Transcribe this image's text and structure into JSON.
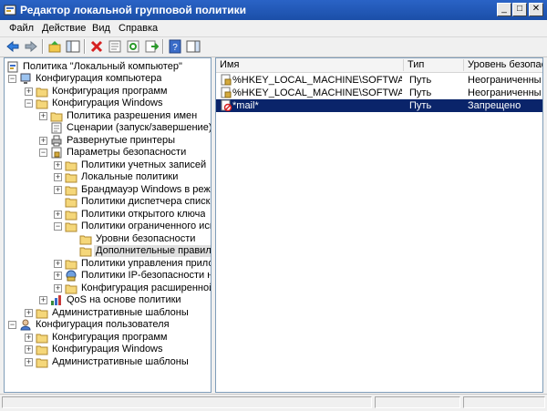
{
  "window": {
    "title": "Редактор локальной групповой политики",
    "min_glyph": "_",
    "max_glyph": "□",
    "close_glyph": "✕"
  },
  "menu": [
    "Файл",
    "Действие",
    "Вид",
    "Справка"
  ],
  "toolbar_icons": [
    "back-icon",
    "forward-icon",
    "up-icon",
    "show-hide-tree-icon",
    "delete-icon",
    "properties-icon",
    "refresh-icon",
    "export-icon",
    "help-icon",
    "view-icon"
  ],
  "tree": [
    {
      "label": "Политика \"Локальный компьютер\"",
      "icon": "policy-icon",
      "expander": ""
    },
    {
      "label": "Конфигурация компьютера",
      "icon": "computer-icon",
      "expander": "−"
    },
    {
      "label": "Конфигурация программ",
      "icon": "folder-icon",
      "expander": "+"
    },
    {
      "label": "Конфигурация Windows",
      "icon": "folder-icon",
      "expander": "−"
    },
    {
      "label": "Политика разрешения имен",
      "icon": "folder-icon",
      "expander": "+"
    },
    {
      "label": "Сценарии (запуск/завершение)",
      "icon": "scripts-icon",
      "expander": ""
    },
    {
      "label": "Развернутые принтеры",
      "icon": "printer-icon",
      "expander": "+"
    },
    {
      "label": "Параметры безопасности",
      "icon": "security-settings-icon",
      "expander": "−"
    },
    {
      "label": "Политики учетных записей",
      "icon": "folder-icon",
      "expander": "+"
    },
    {
      "label": "Локальные политики",
      "icon": "folder-icon",
      "expander": "+"
    },
    {
      "label": "Брандмауэр Windows в режиме по",
      "icon": "folder-icon",
      "expander": "+"
    },
    {
      "label": "Политики диспетчера списка сет",
      "icon": "folder-icon",
      "expander": ""
    },
    {
      "label": "Политики открытого ключа",
      "icon": "folder-icon",
      "expander": "+"
    },
    {
      "label": "Политики ограниченного исполь:",
      "icon": "folder-icon",
      "expander": "−"
    },
    {
      "label": "Уровни безопасности",
      "icon": "folder-icon",
      "expander": ""
    },
    {
      "label": "Дополнительные правила",
      "icon": "folder-icon",
      "expander": "",
      "selected": true
    },
    {
      "label": "Политики управления приложен",
      "icon": "folder-icon",
      "expander": "+"
    },
    {
      "label": "Политики IP-безопасности на \"Лс",
      "icon": "ipsec-icon",
      "expander": "+"
    },
    {
      "label": "Конфигурация расширенной пол",
      "icon": "folder-icon",
      "expander": "+"
    },
    {
      "label": "QoS на основе политики",
      "icon": "qos-icon",
      "expander": "+"
    },
    {
      "label": "Административные шаблоны",
      "icon": "folder-icon",
      "expander": "+"
    },
    {
      "label": "Конфигурация пользователя",
      "icon": "user-icon",
      "expander": "−"
    },
    {
      "label": "Конфигурация программ",
      "icon": "folder-icon",
      "expander": "+"
    },
    {
      "label": "Конфигурация Windows",
      "icon": "folder-icon",
      "expander": "+"
    },
    {
      "label": "Административные шаблоны",
      "icon": "folder-icon",
      "expander": "+"
    }
  ],
  "list": {
    "columns": [
      "Имя",
      "Тип",
      "Уровень безопас..."
    ],
    "rows": [
      {
        "name": "%HKEY_LOCAL_MACHINE\\SOFTWARE\\Micr...",
        "type": "Путь",
        "level": "Неограниченный",
        "icon": "rule-lock-icon"
      },
      {
        "name": "%HKEY_LOCAL_MACHINE\\SOFTWARE\\Micr...",
        "type": "Путь",
        "level": "Неограниченный",
        "icon": "rule-lock-icon"
      },
      {
        "name": "*mail*",
        "type": "Путь",
        "level": "Запрещено",
        "icon": "rule-blocked-icon",
        "selected": true
      }
    ]
  }
}
